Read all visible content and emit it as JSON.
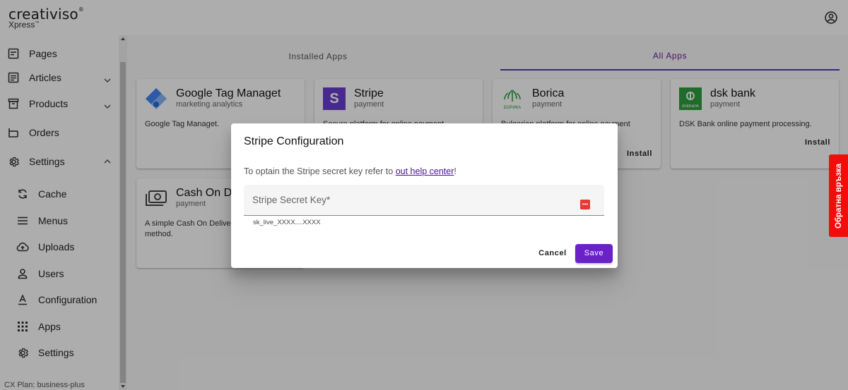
{
  "header": {
    "brand": "creativiso",
    "brand_mark": "®",
    "sub": "Xpress",
    "sub_mark": "™"
  },
  "sidebar": {
    "items": [
      {
        "label": "Pages",
        "icon": "page-icon"
      },
      {
        "label": "Articles",
        "icon": "article-icon"
      },
      {
        "label": "Products",
        "icon": "archive-icon"
      },
      {
        "label": "Orders",
        "icon": "orders-icon"
      },
      {
        "label": "Settings",
        "icon": "gear-icon"
      },
      {
        "label": "Cache",
        "icon": "refresh-icon"
      },
      {
        "label": "Menus",
        "icon": "menu-icon"
      },
      {
        "label": "Uploads",
        "icon": "cloud-upload-icon"
      },
      {
        "label": "Users",
        "icon": "user-icon"
      },
      {
        "label": "Configuration",
        "icon": "text-format-icon"
      },
      {
        "label": "Apps",
        "icon": "apps-grid-icon"
      },
      {
        "label": "Settings",
        "icon": "gear-icon"
      }
    ],
    "plan": "CX Plan: business-plus"
  },
  "tabs": [
    {
      "label": "Installed Apps",
      "active": false
    },
    {
      "label": "All Apps",
      "active": true
    }
  ],
  "apps": [
    {
      "name": "Google Tag Managet",
      "category": "marketing  analytics",
      "description": "Google Tag Managet.",
      "action": ""
    },
    {
      "name": "Stripe",
      "category": "payment",
      "description": "Secure platform for online payment",
      "action": ""
    },
    {
      "name": "Borica",
      "category": "payment",
      "description": "Bulgarian platform for online payment",
      "action": "Install"
    },
    {
      "name": "dsk bank",
      "category": "payment",
      "description": "DSK Bank online payment processing.",
      "action": "Install"
    },
    {
      "name": "Cash On Delivery",
      "category": "payment",
      "description": "A simple Cash On Delivery payment method.",
      "action": ""
    }
  ],
  "dialog": {
    "title": "Stripe Configuration",
    "text_before": "To optain the Stripe secret key refer to ",
    "link": "out help center",
    "text_after": "!",
    "field_label": "Stripe Secret Key*",
    "field_value": "",
    "hint": "sk_live_XXXX....XXXX",
    "cancel": "Cancel",
    "save": "Save"
  },
  "feedback": "Обратна връзка",
  "colors": {
    "accent": "#6b21c8",
    "tab_active": "#5e35b1",
    "feedback": "#f20d0d",
    "stripe": "#6a3fd1",
    "dsk": "#2e9e3e"
  }
}
